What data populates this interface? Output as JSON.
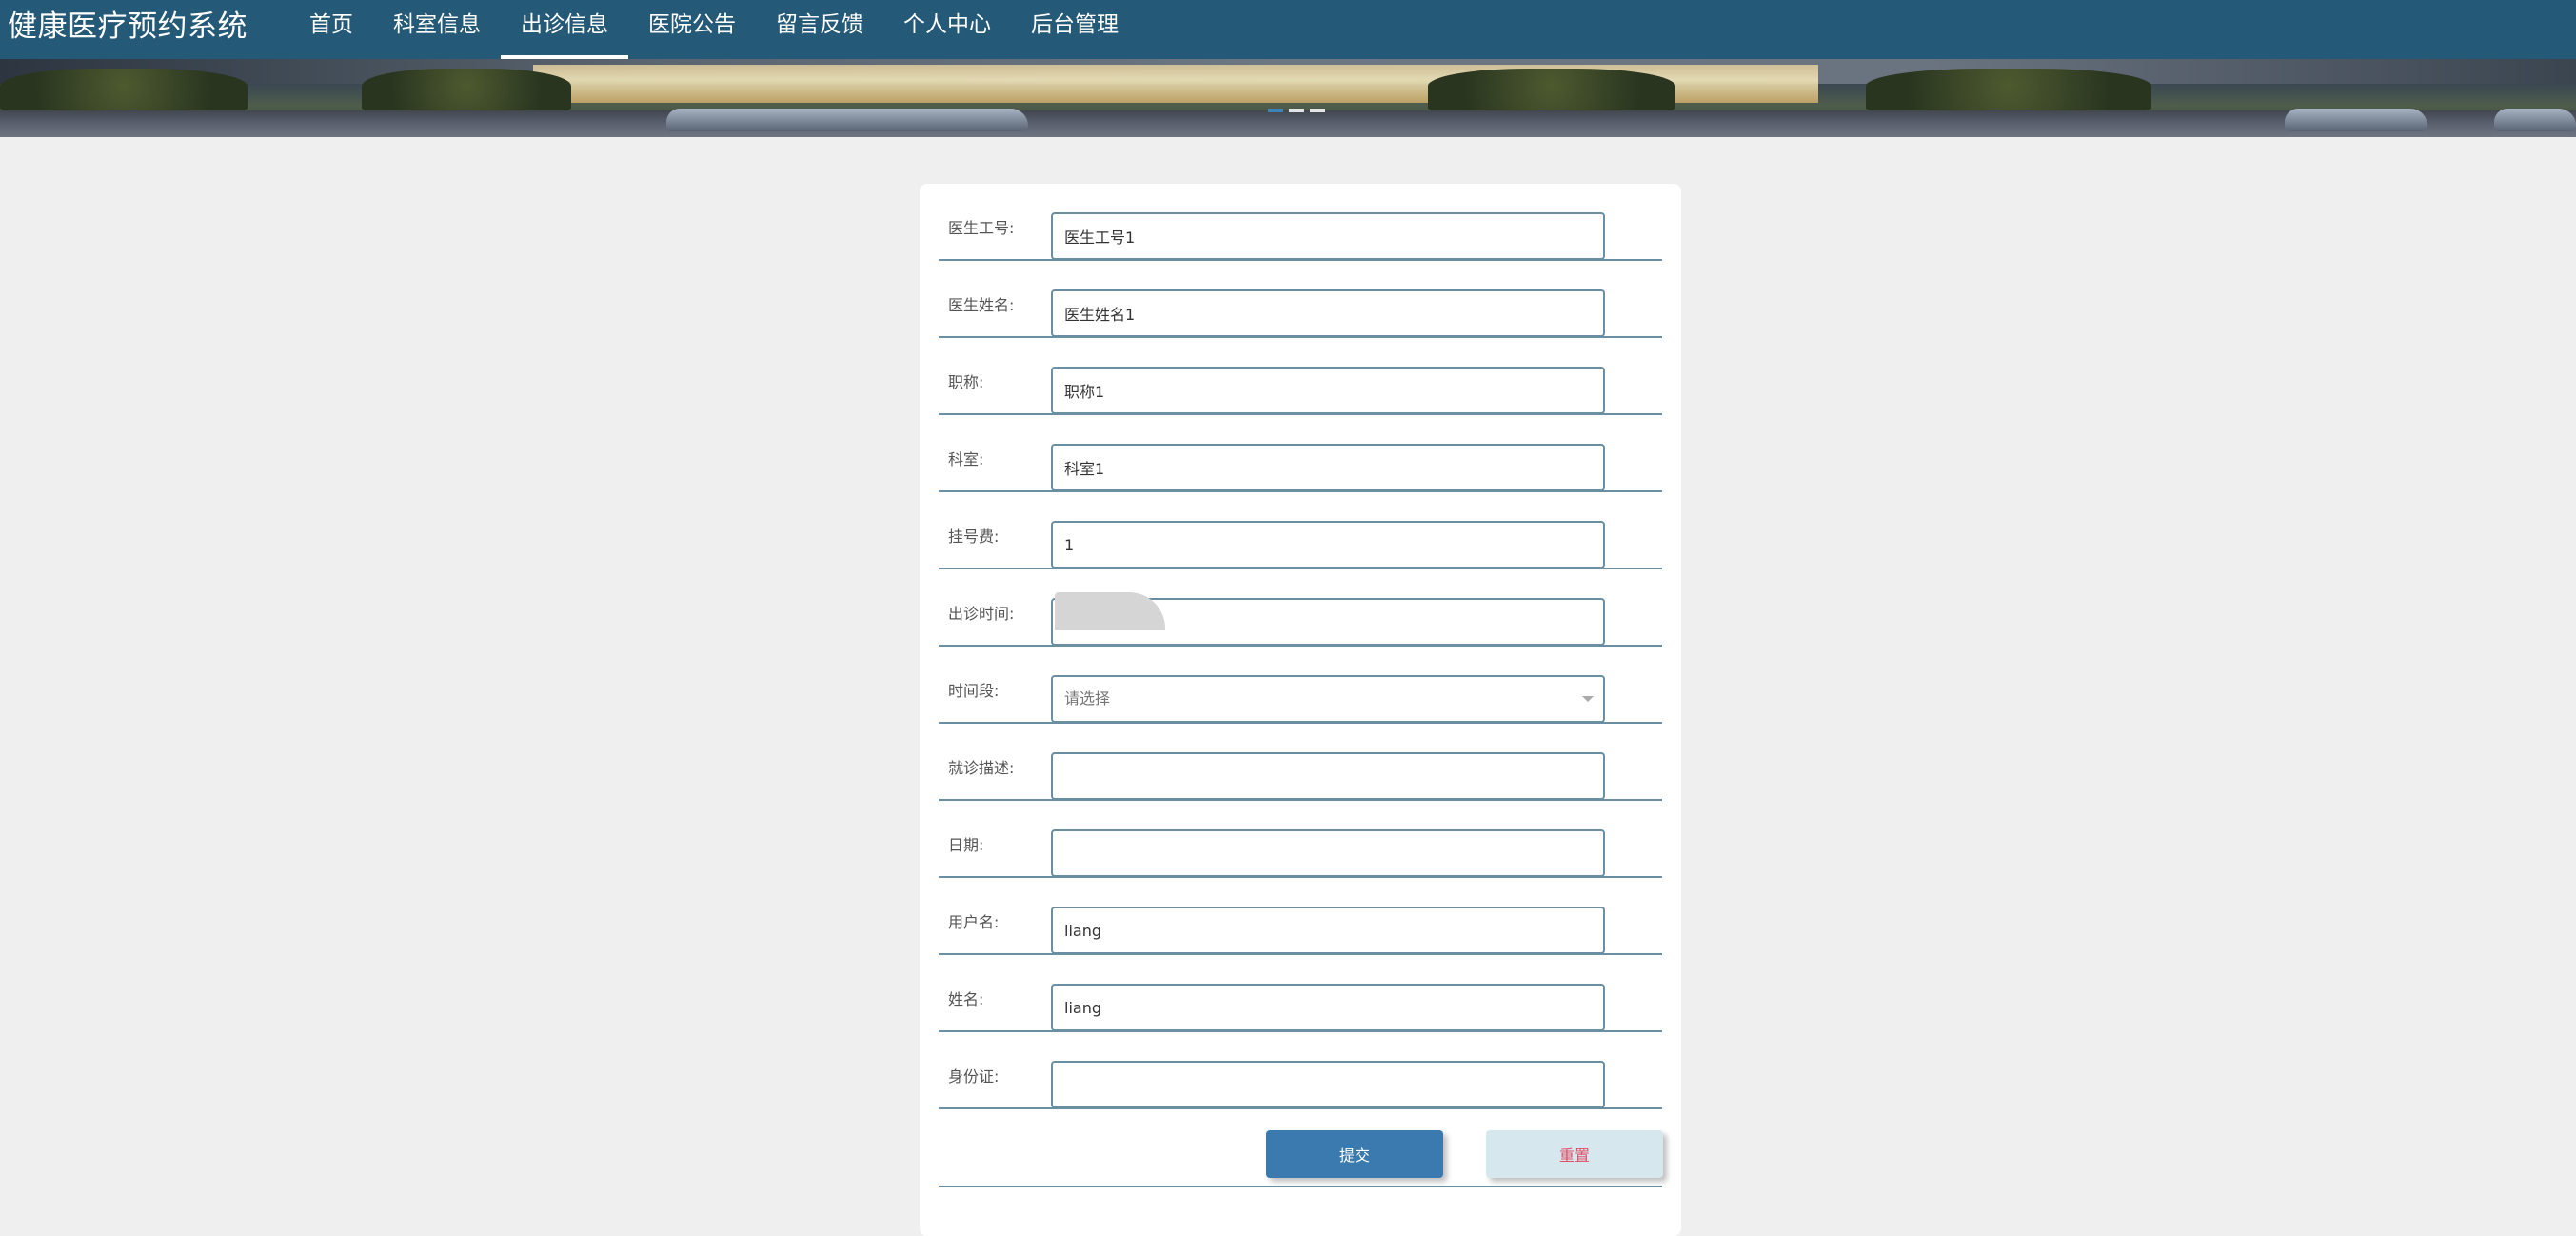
{
  "header": {
    "app_title": "健康医疗预约系统",
    "nav": [
      {
        "label": "首页",
        "active": false
      },
      {
        "label": "科室信息",
        "active": false
      },
      {
        "label": "出诊信息",
        "active": true
      },
      {
        "label": "医院公告",
        "active": false
      },
      {
        "label": "留言反馈",
        "active": false
      },
      {
        "label": "个人中心",
        "active": false
      },
      {
        "label": "后台管理",
        "active": false
      }
    ]
  },
  "banner": {
    "slides": 3,
    "active_slide": 1
  },
  "form": {
    "doctor_id": {
      "label": "医生工号:",
      "value": "医生工号1"
    },
    "doctor_name": {
      "label": "医生姓名:",
      "value": "医生姓名1"
    },
    "title": {
      "label": "职称:",
      "value": "职称1"
    },
    "department": {
      "label": "科室:",
      "value": "科室1"
    },
    "fee": {
      "label": "挂号费:",
      "value": "1"
    },
    "visit_time": {
      "label": "出诊时间:",
      "value": ""
    },
    "time_slot": {
      "label": "时间段:",
      "placeholder": "请选择"
    },
    "description": {
      "label": "就诊描述:",
      "value": ""
    },
    "date": {
      "label": "日期:",
      "value": ""
    },
    "username": {
      "label": "用户名:",
      "value": "liang"
    },
    "name": {
      "label": "姓名:",
      "value": "liang"
    },
    "id_card": {
      "label": "身份证:",
      "value": ""
    },
    "submit_label": "提交",
    "reset_label": "重置"
  },
  "colors": {
    "topbar": "#255978",
    "page_bg": "#efefef",
    "submit": "#3a7aae",
    "reset_bg": "#d7e7ee",
    "reset_text": "#e0506a",
    "border": "#6a8ea2"
  }
}
